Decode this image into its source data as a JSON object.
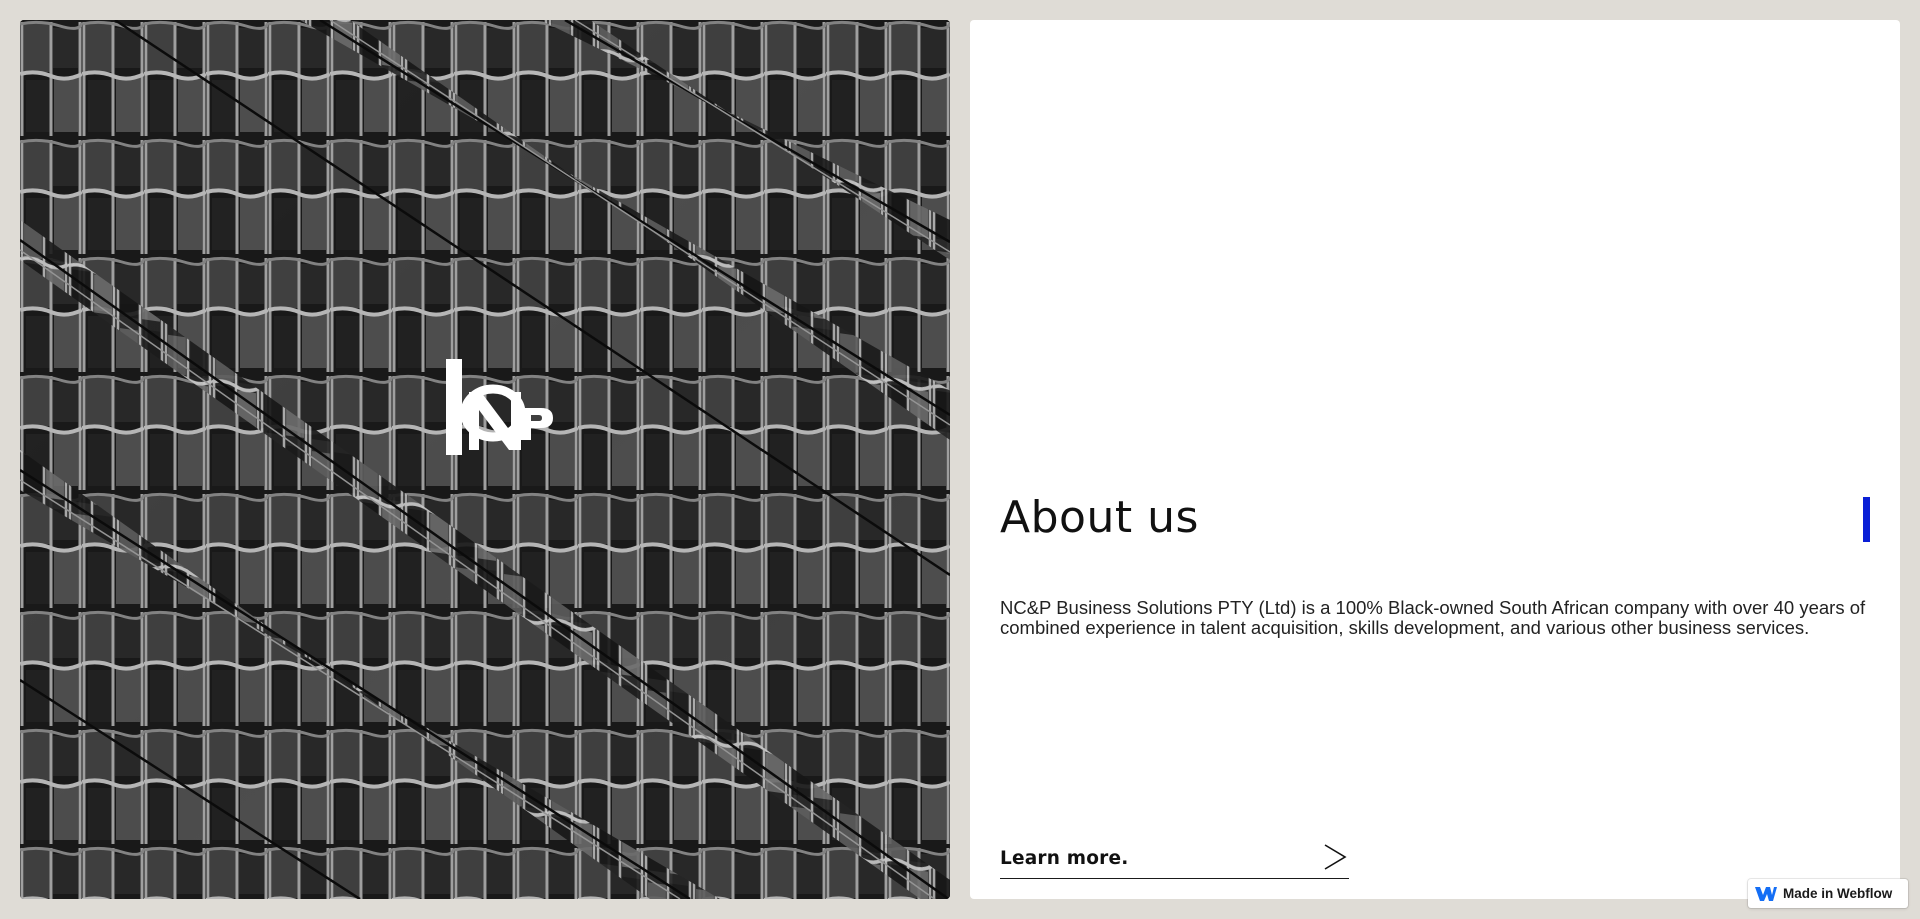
{
  "hero_image": {
    "subject": "black-and-white photo of a glass building facade reflecting windows",
    "logo_text": "NCP"
  },
  "about": {
    "title": "About us",
    "description": "NC&P Business Solutions PTY (Ltd) is a 100% Black-owned South African company with over 40 years of combined experience in talent acquisition, skills development, and various other business services.",
    "learn_more_label": "Learn more.",
    "learn_more_icon": "chevron-right-icon",
    "accent_color": "#0a1fd6"
  },
  "badge": {
    "label": "Made in Webflow",
    "icon": "webflow-logo-icon",
    "icon_color": "#146ef5"
  },
  "colors": {
    "page_background": "#dfdcd6",
    "card_background": "#ffffff",
    "text": "#111111"
  }
}
